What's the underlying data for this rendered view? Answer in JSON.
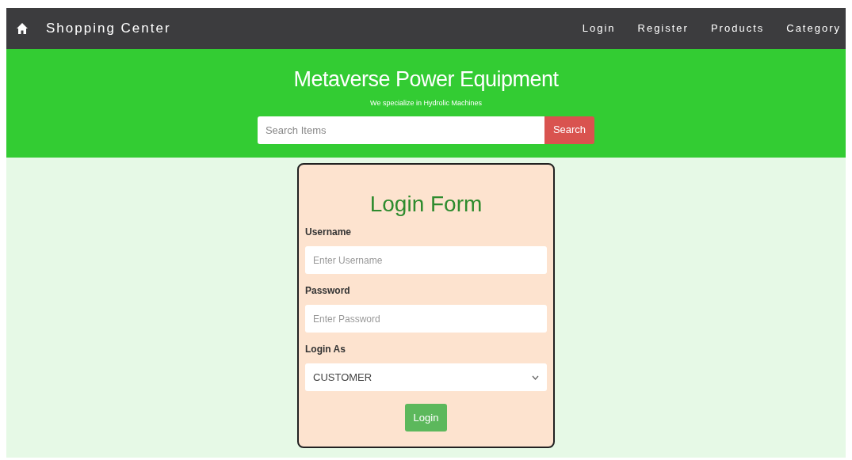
{
  "navbar": {
    "brand": "Shopping Center",
    "links": [
      "Login",
      "Register",
      "Products",
      "Category"
    ]
  },
  "header": {
    "title": "Metaverse Power Equipment",
    "subtitle": "We specialize in Hydrolic Machines",
    "search": {
      "placeholder": "Search Items",
      "button": "Search"
    }
  },
  "login_form": {
    "title": "Login Form",
    "fields": [
      {
        "kind": "text",
        "label": "Username",
        "placeholder": "Enter Username"
      },
      {
        "kind": "password",
        "label": "Password",
        "placeholder": "Enter Password"
      },
      {
        "kind": "select",
        "label": "Login As",
        "value": "CUSTOMER"
      }
    ],
    "button": "Login"
  }
}
